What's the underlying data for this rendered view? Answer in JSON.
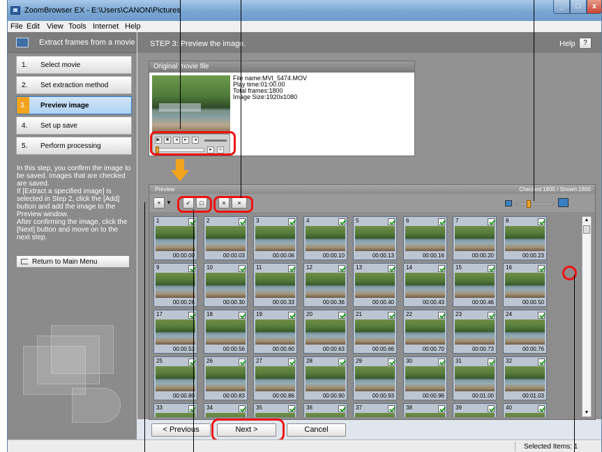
{
  "window": {
    "title": "ZoomBrowser EX - E:\\Users\\CANON\\Pictures",
    "minimize_label": "_",
    "maximize_label": "□",
    "close_label": "x"
  },
  "menu": [
    "File",
    "Edit",
    "View",
    "Tools",
    "Internet",
    "Help"
  ],
  "left_panel": {
    "title": "Extract frames from a movie",
    "steps": [
      {
        "num": "1.",
        "label": "Select movie"
      },
      {
        "num": "2.",
        "label": "Set extraction method"
      },
      {
        "num": "3.",
        "label": "Preview image"
      },
      {
        "num": "4.",
        "label": "Set up save"
      },
      {
        "num": "5.",
        "label": "Perform processing"
      }
    ],
    "description": "In this step, you confirm the image to be saved. Images that are checked are saved.\nIf [Extract a specified image] is selected in Step 2, click the [Add] button and add the image to the Preview window.\nAfter confirming the image, click the [Next] button and move on to the next step.",
    "return_label": "Return to Main Menu"
  },
  "header": {
    "step_title": "STEP 3: Preview the image.",
    "help_label": "Help",
    "help_button": "?"
  },
  "original_movie": {
    "title": "Original movie file",
    "file_name": "File name:MVI_5474.MOV",
    "play_time": "Play time:01:00.00",
    "total_frames": "Total frames:1800",
    "image_size": "Image Size:1920x1080"
  },
  "preview": {
    "title": "Preview",
    "counts": "Checked:1800 / Shown:1800",
    "thumbnails": [
      {
        "num": "1",
        "time": "00:00.00"
      },
      {
        "num": "2",
        "time": "00:00.03"
      },
      {
        "num": "3",
        "time": "00:00.06"
      },
      {
        "num": "4",
        "time": "00:00.10"
      },
      {
        "num": "5",
        "time": "00:00.13"
      },
      {
        "num": "6",
        "time": "00:00.16"
      },
      {
        "num": "7",
        "time": "00:00.20"
      },
      {
        "num": "8",
        "time": "00:00.23"
      },
      {
        "num": "9",
        "time": "00:00.26"
      },
      {
        "num": "10",
        "time": "00:00.30"
      },
      {
        "num": "11",
        "time": "00:00.33"
      },
      {
        "num": "12",
        "time": "00:00.36"
      },
      {
        "num": "13",
        "time": "00:00.40"
      },
      {
        "num": "14",
        "time": "00:00.43"
      },
      {
        "num": "15",
        "time": "00:00.46"
      },
      {
        "num": "16",
        "time": "00:00.50"
      },
      {
        "num": "17",
        "time": "00:00.53"
      },
      {
        "num": "18",
        "time": "00:00.56"
      },
      {
        "num": "19",
        "time": "00:00.60"
      },
      {
        "num": "20",
        "time": "00:00.63"
      },
      {
        "num": "21",
        "time": "00:00.66"
      },
      {
        "num": "22",
        "time": "00:00.70"
      },
      {
        "num": "23",
        "time": "00:00.73"
      },
      {
        "num": "24",
        "time": "00:00.76"
      },
      {
        "num": "25",
        "time": "00:00.80"
      },
      {
        "num": "26",
        "time": "00:00.83"
      },
      {
        "num": "27",
        "time": "00:00.86"
      },
      {
        "num": "28",
        "time": "00:00.90"
      },
      {
        "num": "29",
        "time": "00:00.93"
      },
      {
        "num": "30",
        "time": "00:00.96"
      },
      {
        "num": "31",
        "time": "00:01.00"
      },
      {
        "num": "32",
        "time": "00:01.03"
      },
      {
        "num": "33",
        "time": ""
      },
      {
        "num": "34",
        "time": ""
      },
      {
        "num": "35",
        "time": ""
      },
      {
        "num": "36",
        "time": ""
      },
      {
        "num": "37",
        "time": ""
      },
      {
        "num": "38",
        "time": ""
      },
      {
        "num": "39",
        "time": ""
      },
      {
        "num": "40",
        "time": ""
      }
    ]
  },
  "buttons": {
    "previous": "< Previous",
    "next": "Next >",
    "cancel": "Cancel"
  },
  "status": {
    "selected_items": "Selected Items: 1"
  },
  "colors": {
    "accent_orange": "#f2a41d",
    "highlight_red": "#ee1111",
    "active_step": "#b0d2f2"
  }
}
